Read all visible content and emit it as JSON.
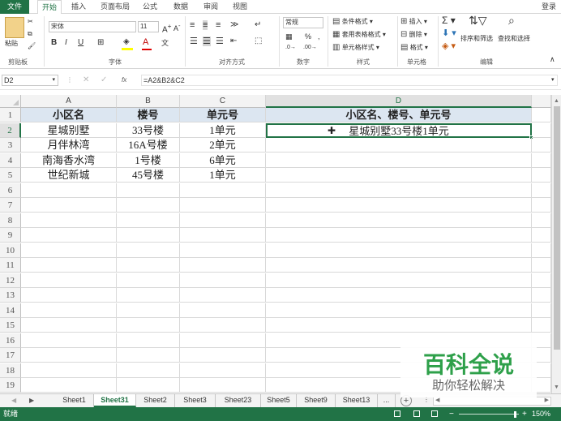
{
  "menu": {
    "file": "文件",
    "home": "开始",
    "insert": "插入",
    "layout": "页面布局",
    "formulas": "公式",
    "data": "数据",
    "review": "审阅",
    "view": "视图",
    "login": "登录"
  },
  "ribbon": {
    "paste": "粘贴",
    "font_name": "宋体",
    "font_size": "11",
    "number_format": "常规",
    "cond_format": "条件格式",
    "table_format": "套用表格格式",
    "cell_style": "单元格样式",
    "insert": "插入",
    "delete": "删除",
    "format": "格式",
    "sort_filter": "排序和筛选",
    "find_select": "查找和选择",
    "groups": {
      "clipboard": "剪贴板",
      "font": "字体",
      "align": "对齐方式",
      "number": "数字",
      "style": "样式",
      "cells": "单元格",
      "editing": "编辑"
    }
  },
  "formula_bar": {
    "name_box": "D2",
    "fx": "fx",
    "formula": "=A2&B2&C2"
  },
  "columns": [
    "A",
    "B",
    "C",
    "D"
  ],
  "rows": [
    "1",
    "2",
    "3",
    "4",
    "5",
    "6",
    "7",
    "8",
    "9",
    "10",
    "11",
    "12",
    "13",
    "14",
    "15",
    "16",
    "17",
    "18",
    "19"
  ],
  "table": {
    "header": [
      "小区名",
      "楼号",
      "单元号",
      "小区名、楼号、单元号"
    ],
    "data": [
      [
        "星城别墅",
        "33号楼",
        "1单元",
        "星城别墅33号楼1单元"
      ],
      [
        "月伴林湾",
        "16A号楼",
        "2单元",
        ""
      ],
      [
        "南海香水湾",
        "1号楼",
        "6单元",
        ""
      ],
      [
        "世纪新城",
        "45号楼",
        "1单元",
        ""
      ]
    ]
  },
  "sheets": [
    "Sheet1",
    "Sheet31",
    "Sheet2",
    "Sheet3",
    "Sheet23",
    "Sheet5",
    "Sheet9",
    "Sheet13",
    "..."
  ],
  "active_sheet": "Sheet31",
  "status": {
    "ready": "就绪",
    "zoom": "150%"
  },
  "watermark": {
    "title": "百科全说",
    "subtitle": "助你轻松解决"
  },
  "colors": {
    "accent": "#217346",
    "header_fill": "#dce6f1",
    "watermark_green": "#2ea04a"
  }
}
